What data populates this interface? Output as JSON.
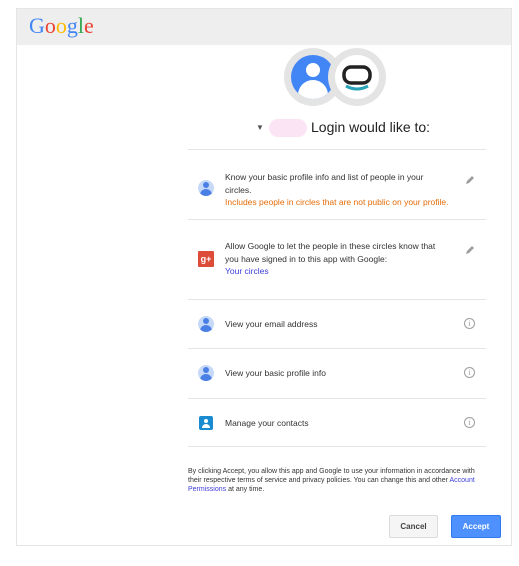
{
  "header": {
    "logo_letters": [
      {
        "ch": "G",
        "color": "#4285f4"
      },
      {
        "ch": "o",
        "color": "#ea4335"
      },
      {
        "ch": "o",
        "color": "#fbbc05"
      },
      {
        "ch": "g",
        "color": "#4285f4"
      },
      {
        "ch": "l",
        "color": "#34a853"
      },
      {
        "ch": "e",
        "color": "#ea4335"
      }
    ]
  },
  "title": {
    "text": "Login would like to:"
  },
  "permissions": [
    {
      "icon": "user-icon",
      "text_parts": [
        {
          "t": "Know your basic profile info and list of people in your circles.",
          "style": "normal"
        },
        {
          "t": "Includes people in circles that are not public on your profile.",
          "style": "orange"
        }
      ],
      "action_icon": "edit-icon"
    },
    {
      "icon": "google-plus-icon",
      "text_parts": [
        {
          "t": "Allow Google to let the people in these circles know that you have signed in to this app with Google:",
          "style": "normal"
        },
        {
          "t": "Your circles",
          "style": "link"
        }
      ],
      "action_icon": "edit-icon"
    },
    {
      "icon": "user-icon",
      "text_parts": [
        {
          "t": "View your email address",
          "style": "normal"
        }
      ],
      "action_icon": "info-icon"
    },
    {
      "icon": "user-icon",
      "text_parts": [
        {
          "t": "View your basic profile info",
          "style": "normal"
        }
      ],
      "action_icon": "info-icon"
    },
    {
      "icon": "contacts-icon",
      "text_parts": [
        {
          "t": "Manage your contacts",
          "style": "normal"
        }
      ],
      "action_icon": "info-icon"
    }
  ],
  "legal": {
    "before": "By clicking Accept, you allow this app and Google to use your information in accordance with their respective terms of service and privacy policies. You can change this and other",
    "link": "Account Permissions",
    "after": "at any time."
  },
  "buttons": {
    "cancel": "Cancel",
    "accept": "Accept"
  },
  "colors": {
    "accent": "#4d90fe",
    "orange_warning": "#e46c0a",
    "link": "#3d3de0",
    "gplus": "#dd4b39"
  }
}
